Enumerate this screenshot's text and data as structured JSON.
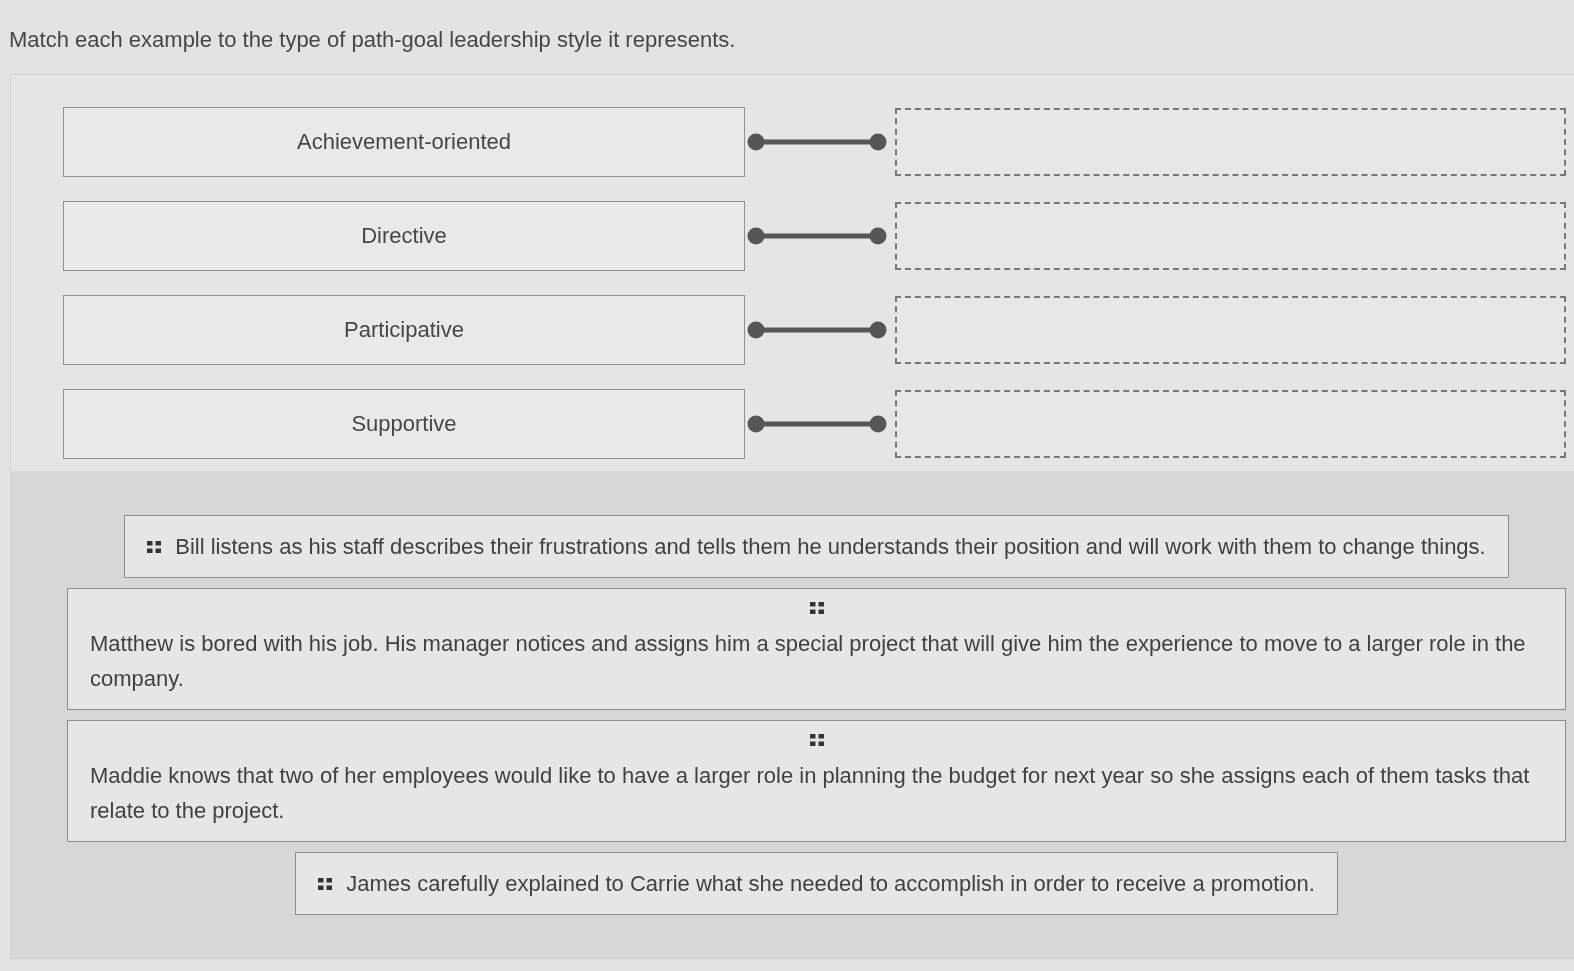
{
  "prompt": "Match each example to the type of path-goal leadership style it represents.",
  "styles": [
    {
      "label": "Achievement-oriented"
    },
    {
      "label": "Directive"
    },
    {
      "label": "Participative"
    },
    {
      "label": "Supportive"
    }
  ],
  "examples": [
    {
      "text": "Bill listens as his staff describes their frustrations and tells them he understands their position and will work with them to change things."
    },
    {
      "text": "Matthew is bored with his job. His manager notices and assigns him a special project that will give him the experience to move to a larger role in the company."
    },
    {
      "text": "Maddie knows that two of her employees would like to have a larger role in planning the budget for next year so she assigns each of them tasks that relate to the project."
    },
    {
      "text": "James carefully explained to Carrie what she needed to accomplish in order to receive a promotion."
    }
  ]
}
